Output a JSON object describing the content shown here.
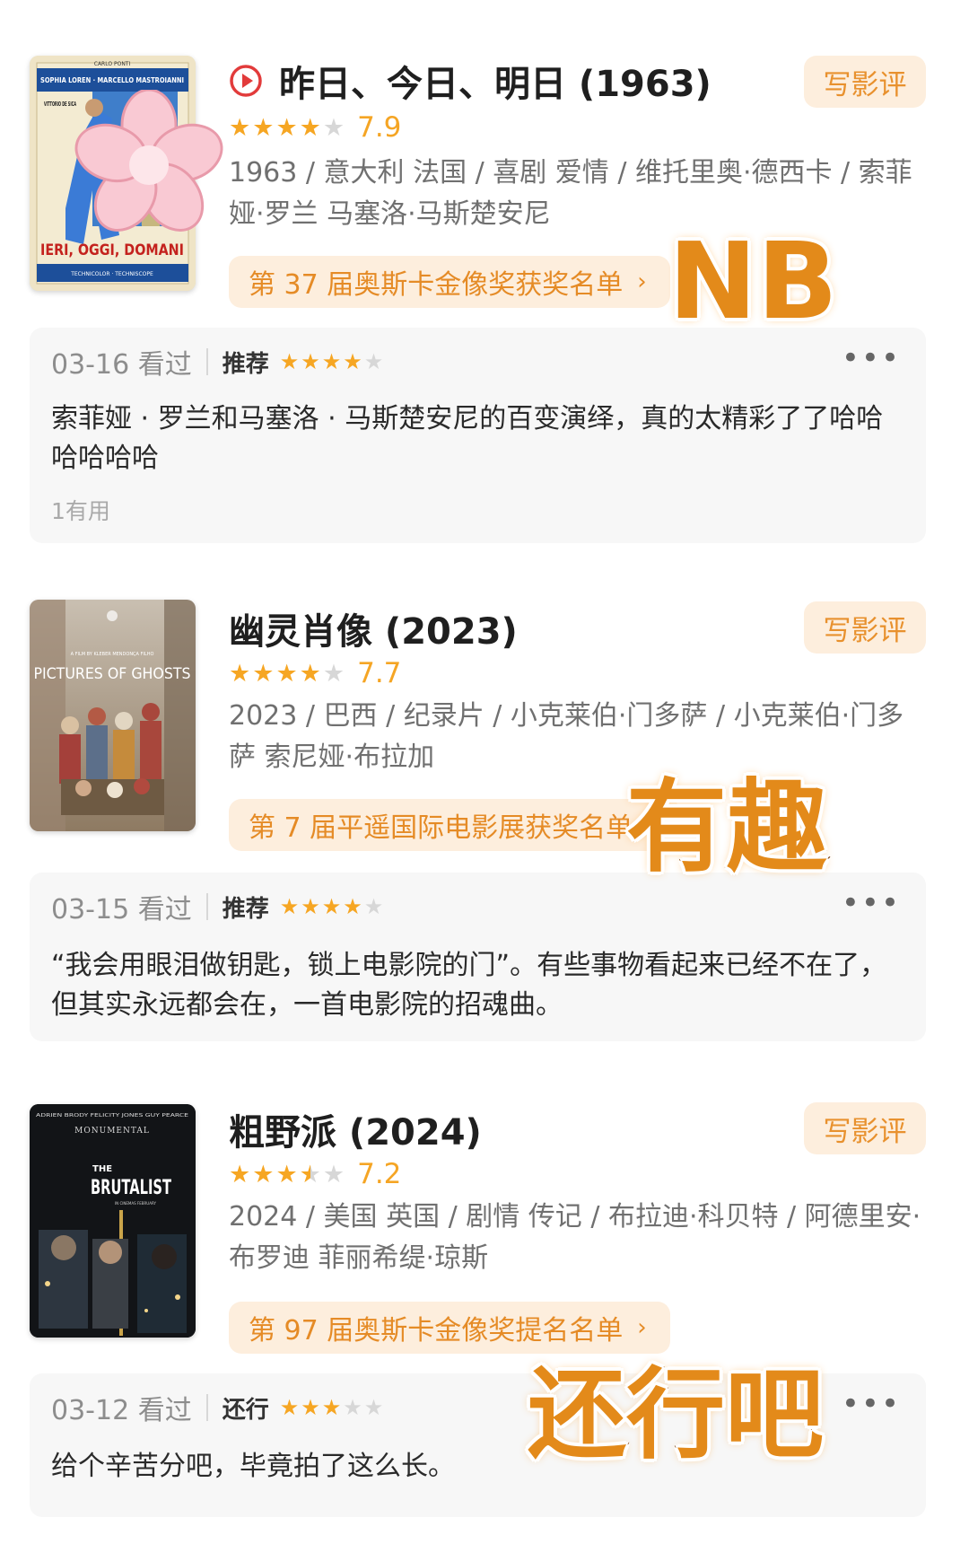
{
  "colors": {
    "accent": "#f5a524",
    "pill_bg": "#fdeedd",
    "pill_text": "#e58b26",
    "review_bg": "#f7f7f7",
    "play": "#e23b3b"
  },
  "entries": [
    {
      "title": "昨日、今日、明日 (1963)",
      "has_play_icon": true,
      "write_button": "写影评",
      "rating_stars": 4,
      "score": "7.9",
      "meta": "1963 / 意大利 法国 / 喜剧 爱情 / 维托里奥·德西卡 / 索菲娅·罗兰 马塞洛·马斯楚安尼",
      "award": "第 37 届奥斯卡金像奖获奖名单",
      "poster": {
        "line1": "CARLO PONTI",
        "line2": "SOPHIA LOREN · MARCELLO MASTROIANNI",
        "line3": "VITTORIO DE SICA",
        "title": "IERI, OGGI, DOMANI",
        "footer": "TECHNICOLOR · TECHNISCOPE"
      },
      "review": {
        "date": "03-16 看过",
        "label": "推荐",
        "stars": 4,
        "text": "索菲娅 · 罗兰和马塞洛 · 马斯楚安尼的百变演绎，真的太精彩了了哈哈哈哈哈哈",
        "useful": "1有用"
      },
      "sticker": "NB"
    },
    {
      "title": "幽灵肖像 (2023)",
      "has_play_icon": false,
      "write_button": "写影评",
      "rating_stars": 4,
      "score": "7.7",
      "meta": "2023 / 巴西 / 纪录片 / 小克莱伯·门多萨 / 小克莱伯·门多萨 索尼娅·布拉加",
      "award": "第 7 届平遥国际电影展获奖名单",
      "poster": {
        "title": "PICTURES OF GHOSTS",
        "small": "A FILM BY KLEBER MENDONÇA FILHO"
      },
      "review": {
        "date": "03-15 看过",
        "label": "推荐",
        "stars": 4,
        "text": "“我会用眼泪做钥匙，锁上电影院的门”。有些事物看起来已经不在了，但其实永远都会在，一首电影院的招魂曲。"
      },
      "sticker": "有趣"
    },
    {
      "title": "粗野派 (2024)",
      "has_play_icon": false,
      "write_button": "写影评",
      "rating_stars": 3.5,
      "score": "7.2",
      "meta": "2024 / 美国 英国 / 剧情 传记 / 布拉迪·科贝特 / 阿德里安·布罗迪 菲丽希缇·琼斯",
      "award": "第 97 届奥斯卡金像奖提名名单",
      "poster": {
        "credits": "ADRIEN BRODY   FELICITY JONES   GUY PEARCE",
        "line": "MONUMENTAL",
        "title_small": "THE",
        "title": "BRUTALIST",
        "footer": "IN CINEMAS FEBRUARY"
      },
      "review": {
        "date": "03-12 看过",
        "label": "还行",
        "stars": 3,
        "text": "给个辛苦分吧，毕竟拍了这么长。"
      },
      "sticker": "还行吧"
    }
  ]
}
